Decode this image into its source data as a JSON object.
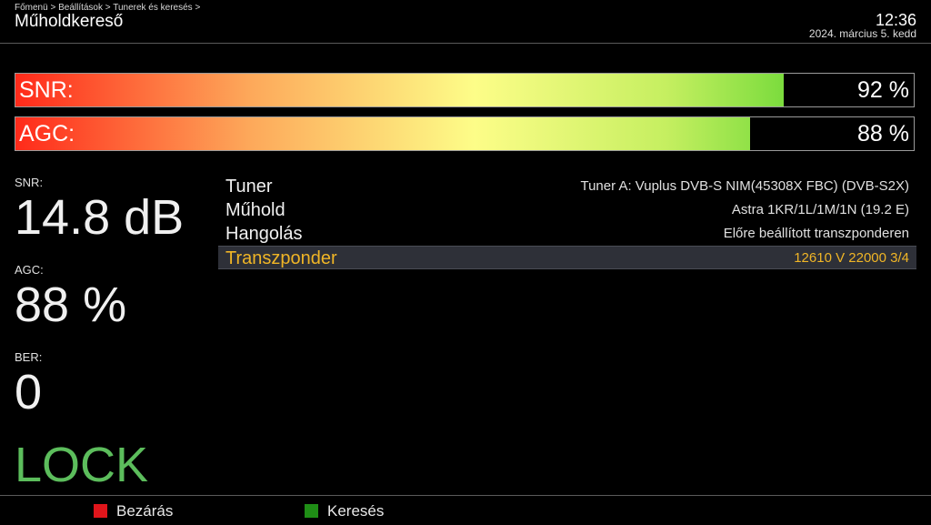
{
  "header": {
    "breadcrumb": "Főmenü > Beállítások > Tunerek és keresés >",
    "title": "Műholdkereső",
    "time": "12:36",
    "date": "2024. március  5. kedd"
  },
  "meters": {
    "snr": {
      "label": "SNR:",
      "value_text": "92 %",
      "level": 0.92
    },
    "agc": {
      "label": "AGC:",
      "value_text": "88 %",
      "level": 0.88
    },
    "gradient_colors": [
      "#ff2a1a",
      "#fda85a",
      "#fdfd88",
      "#c5ef60",
      "#52d12a"
    ]
  },
  "stats": {
    "snr_label": "SNR:",
    "snr_value": "14.8 dB",
    "agc_label": "AGC:",
    "agc_value": "88 %",
    "ber_label": "BER:",
    "ber_value": "0",
    "lock_status": "LOCK"
  },
  "info": [
    {
      "key": "Tuner",
      "value": "Tuner A: Vuplus DVB-S NIM(45308X FBC) (DVB-S2X)",
      "selected": false
    },
    {
      "key": "Műhold",
      "value": "Astra 1KR/1L/1M/1N (19.2 E)",
      "selected": false
    },
    {
      "key": "Hangolás",
      "value": "Előre beállított transzponderen",
      "selected": false
    },
    {
      "key": "Transzponder",
      "value": "12610 V 22000 3/4",
      "selected": true
    }
  ],
  "footer": {
    "red_button": {
      "label": "Bezárás",
      "color": "#e0151b"
    },
    "green_button": {
      "label": "Keresés",
      "color": "#1f8e16"
    }
  },
  "colors": {
    "lock": "#5cbd5c",
    "selected_text": "#f0b526",
    "selected_bg": "#2e3038"
  }
}
